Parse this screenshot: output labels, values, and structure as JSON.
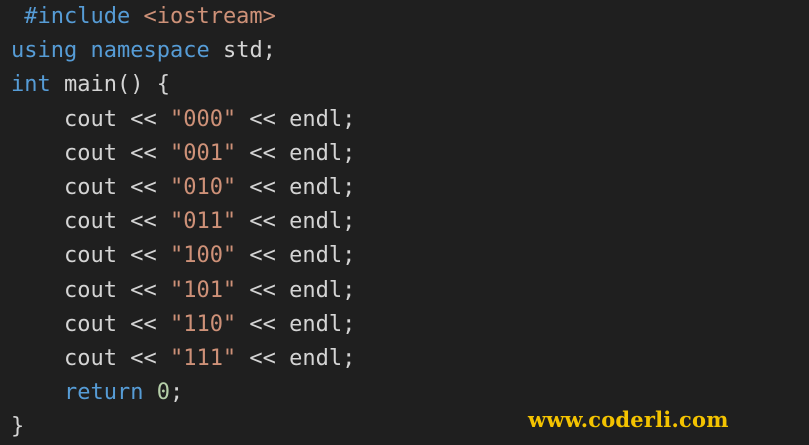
{
  "code": {
    "lines": [
      [
        {
          "t": " ",
          "c": "ident"
        },
        {
          "t": "#include",
          "c": "preproc"
        },
        {
          "t": " ",
          "c": "ident"
        },
        {
          "t": "<iostream>",
          "c": "include-path"
        }
      ],
      [
        {
          "t": "using",
          "c": "kw"
        },
        {
          "t": " ",
          "c": "ident"
        },
        {
          "t": "namespace",
          "c": "kw"
        },
        {
          "t": " std;",
          "c": "ident"
        }
      ],
      [
        {
          "t": "int",
          "c": "type"
        },
        {
          "t": " ",
          "c": "ident"
        },
        {
          "t": "main",
          "c": "ident"
        },
        {
          "t": "() {",
          "c": "punct"
        }
      ],
      [
        {
          "t": "    cout << ",
          "c": "ident"
        },
        {
          "t": "\"000\"",
          "c": "str"
        },
        {
          "t": " << endl;",
          "c": "ident"
        }
      ],
      [
        {
          "t": "    cout << ",
          "c": "ident"
        },
        {
          "t": "\"001\"",
          "c": "str"
        },
        {
          "t": " << endl;",
          "c": "ident"
        }
      ],
      [
        {
          "t": "    cout << ",
          "c": "ident"
        },
        {
          "t": "\"010\"",
          "c": "str"
        },
        {
          "t": " << endl;",
          "c": "ident"
        }
      ],
      [
        {
          "t": "    cout << ",
          "c": "ident"
        },
        {
          "t": "\"011\"",
          "c": "str"
        },
        {
          "t": " << endl;",
          "c": "ident"
        }
      ],
      [
        {
          "t": "    cout << ",
          "c": "ident"
        },
        {
          "t": "\"100\"",
          "c": "str"
        },
        {
          "t": " << endl;",
          "c": "ident"
        }
      ],
      [
        {
          "t": "    cout << ",
          "c": "ident"
        },
        {
          "t": "\"101\"",
          "c": "str"
        },
        {
          "t": " << endl;",
          "c": "ident"
        }
      ],
      [
        {
          "t": "    cout << ",
          "c": "ident"
        },
        {
          "t": "\"110\"",
          "c": "str"
        },
        {
          "t": " << endl;",
          "c": "ident"
        }
      ],
      [
        {
          "t": "    cout << ",
          "c": "ident"
        },
        {
          "t": "\"111\"",
          "c": "str"
        },
        {
          "t": " << endl;",
          "c": "ident"
        }
      ],
      [
        {
          "t": "    ",
          "c": "ident"
        },
        {
          "t": "return",
          "c": "ctrl"
        },
        {
          "t": " ",
          "c": "ident"
        },
        {
          "t": "0",
          "c": "num"
        },
        {
          "t": ";",
          "c": "punct"
        }
      ],
      [
        {
          "t": "}",
          "c": "punct"
        }
      ]
    ]
  },
  "watermark": {
    "text": "www.coderli.com"
  },
  "colors": {
    "background": "#1f1f1f",
    "keyword": "#569cd6",
    "type": "#4ec9b0",
    "string": "#ce9178",
    "number": "#b5cea8",
    "default": "#d4d4d4",
    "watermark": "#f4c300"
  }
}
